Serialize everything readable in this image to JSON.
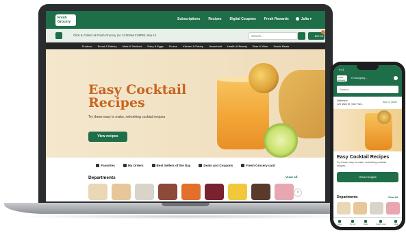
{
  "colors": {
    "brand": "#1f6e4a",
    "accent": "#c8641f",
    "badge": "#e8752a"
  },
  "laptop": {
    "logo": "Fresh Grocery",
    "nav": [
      "Subscriptions",
      "Recipes",
      "Digital Coupons",
      "Fresh Rewards"
    ],
    "user": "Julia",
    "store_info": "Click & Collect at Fresh Grocery | In 11:00AM-1:00PM, Sep 14",
    "search_placeholder": "Search...",
    "cart_total": "$22.46",
    "categories": [
      "Produce",
      "Bread & Bakery",
      "Meat & Seafood",
      "Dairy & Eggs",
      "Frozen",
      "Kitchen & Pantry",
      "Household",
      "Health & Beauty",
      "Beer & Wine",
      "Snack Meals"
    ],
    "hero": {
      "title": "Easy Cocktail Recipes",
      "subtitle": "Try these easy to make, refreshing cocktail recipes",
      "button": "View recipes"
    },
    "quick_links": [
      "Favorites",
      "My Orders",
      "Best Sellers of the Day",
      "Deals and Coupons",
      "Fresh Grocery card"
    ],
    "departments_title": "Departments",
    "view_all": "View all",
    "dept_colors": [
      "#e9d7b5",
      "#e7c79a",
      "#d9d4c9",
      "#8b4a3a",
      "#e36f2c",
      "#7a2230",
      "#f0c83a",
      "#5a3a2a",
      "#e8a7b0"
    ]
  },
  "phone": {
    "time": "9:41",
    "logo": "Fresh Grocery",
    "shopping_label": "I'm shopping ...",
    "search_placeholder": "Search...",
    "delivery_line1": "Delivery ▾",
    "delivery_line2": "123 Main St, San Fran...",
    "delivery_time": "Sep 14 | 9AM",
    "hero_title": "Easy Cocktail Recipes",
    "hero_subtitle": "Try these easy to make, refreshing cocktail recipes.",
    "hero_button": "View recipes",
    "departments_title": "Departments",
    "view_all": "View all",
    "dept_colors": [
      "#e9d7b5",
      "#e7c79a",
      "#d9d4c9",
      "#e8a7b0"
    ],
    "nav": [
      "Home",
      "My List",
      "Deals",
      "Quality Links",
      "More"
    ]
  }
}
